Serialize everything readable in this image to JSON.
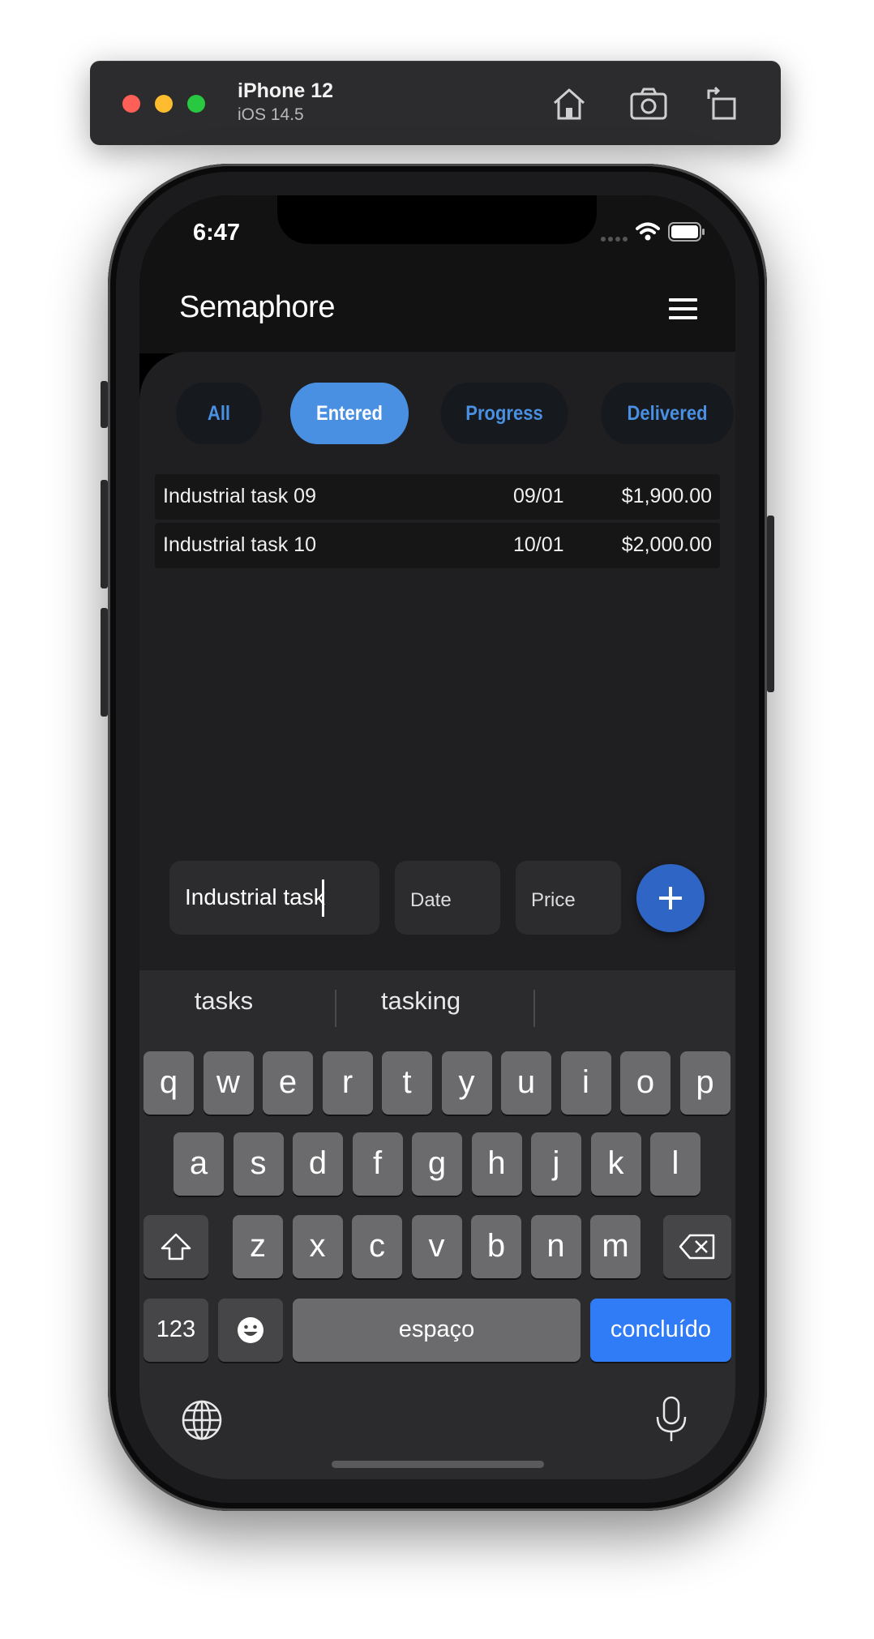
{
  "simulator": {
    "device_name": "iPhone 12",
    "os_version": "iOS 14.5"
  },
  "status_bar": {
    "time": "6:47"
  },
  "app": {
    "title": "Semaphore",
    "tabs": [
      {
        "label": "All",
        "active": false
      },
      {
        "label": "Entered",
        "active": true
      },
      {
        "label": "Progress",
        "active": false
      },
      {
        "label": "Delivered",
        "active": false
      }
    ],
    "tasks": [
      {
        "name": "Industrial task 09",
        "date": "09/01",
        "price": "$1,900.00"
      },
      {
        "name": "Industrial task 10",
        "date": "10/01",
        "price": "$2,000.00"
      }
    ],
    "form": {
      "name_value": "Industrial task",
      "date_placeholder": "Date",
      "price_placeholder": "Price",
      "add_label": "+"
    }
  },
  "keyboard": {
    "suggestions": [
      "tasks",
      "tasking",
      ""
    ],
    "row1": [
      "q",
      "w",
      "e",
      "r",
      "t",
      "y",
      "u",
      "i",
      "o",
      "p"
    ],
    "row2": [
      "a",
      "s",
      "d",
      "f",
      "g",
      "h",
      "j",
      "k",
      "l"
    ],
    "row3": [
      "z",
      "x",
      "c",
      "v",
      "b",
      "n",
      "m"
    ],
    "numbers_label": "123",
    "space_label": "espaço",
    "done_label": "concluído"
  },
  "colors": {
    "accent": "#4a90e2",
    "fab": "#2f66c6",
    "done_key": "#2f7cf6"
  }
}
